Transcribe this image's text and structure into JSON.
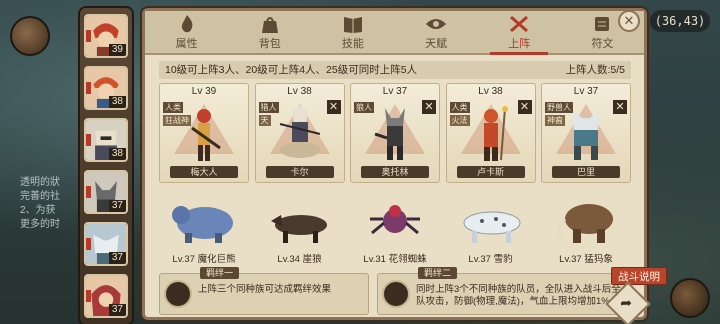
{
  "world": {
    "coords": "(36,43)",
    "left_text": [
      "透明的狀",
      "完善的社",
      "2、为获",
      "更多的时"
    ]
  },
  "heroes": [
    {
      "level": "39",
      "icon": "red-hair-hero-portrait"
    },
    {
      "level": "38",
      "icon": "orange-hair-hero-portrait"
    },
    {
      "level": "38",
      "icon": "armored-hero-portrait"
    },
    {
      "level": "37",
      "icon": "wolf-hero-portrait"
    },
    {
      "level": "37",
      "icon": "white-beast-hero-portrait"
    },
    {
      "level": "37",
      "icon": "red-hood-hero-portrait"
    }
  ],
  "tabs": [
    {
      "label": "属性",
      "icon": "flame-icon"
    },
    {
      "label": "背包",
      "icon": "bag-icon"
    },
    {
      "label": "技能",
      "icon": "book-icon"
    },
    {
      "label": "天赋",
      "icon": "eye-icon"
    },
    {
      "label": "上阵",
      "icon": "crossed-swords-icon",
      "active": true
    },
    {
      "label": "符文",
      "icon": "scroll-icon"
    }
  ],
  "info": {
    "rule": "10级可上阵3人、20级可上阵4人、25级可同时上阵5人",
    "count": "上阵人数:5/5"
  },
  "roster": [
    {
      "lv": "Lv 39",
      "race": "人类",
      "race2": "狂战神",
      "name": "梅大人",
      "removable": false,
      "color": "#b8442c"
    },
    {
      "lv": "Lv 38",
      "race": "猎人",
      "race2": "天",
      "name": "卡尔",
      "removable": true,
      "color": "#d8d0c0"
    },
    {
      "lv": "Lv 37",
      "race": "狼人",
      "race2": "",
      "name": "奥托林",
      "removable": true,
      "color": "#8a8a8a"
    },
    {
      "lv": "Lv 38",
      "race": "人类",
      "race2": "火法",
      "name": "卢卡斯",
      "removable": true,
      "color": "#c24a2a"
    },
    {
      "lv": "Lv 37",
      "race": "野兽人",
      "race2": "神裔",
      "name": "巴里",
      "removable": true,
      "color": "#4a7a8a"
    }
  ],
  "pets": [
    {
      "label": "Lv.37 魔化巨熊",
      "color": "#6a86b8"
    },
    {
      "label": "Lv.34 崖狼",
      "color": "#5a4a3a"
    },
    {
      "label": "Lv.31 花翎蜘蛛",
      "color": "#7a3a6a"
    },
    {
      "label": "Lv.37 雪豹",
      "color": "#e8eef0"
    },
    {
      "label": "Lv.37 猛犸象",
      "color": "#7a5a3a"
    }
  ],
  "bonds": [
    {
      "title": "羁绊一",
      "text": "上阵三个同种族可达成羁绊效果"
    },
    {
      "title": "羁绊二",
      "text": "同时上阵3个不同种族的队员，全队进入战斗后全队攻击，防御(物理,魔法)，气血上限均增加1%"
    }
  ],
  "buttons": {
    "help": "战斗说明",
    "close": "✕",
    "next": "➦"
  }
}
